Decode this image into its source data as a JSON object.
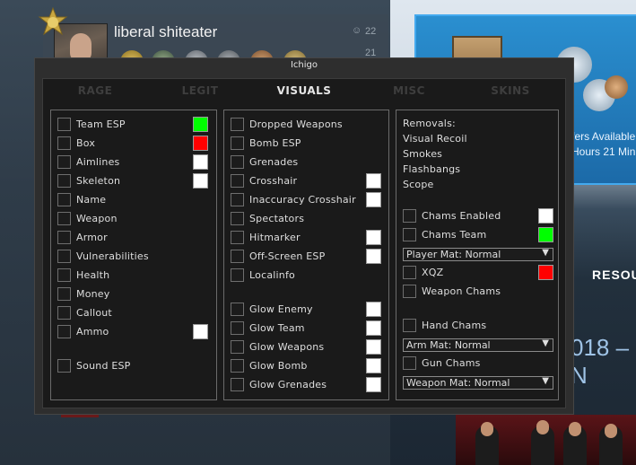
{
  "colors": {
    "team_esp": "#00ff00",
    "box": "#ff0000",
    "white": "#ffffff",
    "chams_team": "#00ff00",
    "xqz": "#ff0000"
  },
  "background": {
    "username": "liberal shiteater",
    "stat_1": "22",
    "stat_2": "21",
    "promo_line_1": "ffers Available",
    "promo_line_2": "Hours  21 Min",
    "resources_label": "RESOU",
    "year_text": "018 – N",
    "stray_s": "s"
  },
  "menu": {
    "title": "Ichigo",
    "tabs": [
      {
        "label": "RAGE",
        "active": false
      },
      {
        "label": "LEGIT",
        "active": false
      },
      {
        "label": "VISUALS",
        "active": true
      },
      {
        "label": "MISC",
        "active": false
      },
      {
        "label": "SKINS",
        "active": false
      }
    ],
    "col1": {
      "team_esp": "Team ESP",
      "box": "Box",
      "aimlines": "Aimlines",
      "skeleton": "Skeleton",
      "name": "Name",
      "weapon": "Weapon",
      "armor": "Armor",
      "vulnerabilities": "Vulnerabilities",
      "health": "Health",
      "money": "Money",
      "callout": "Callout",
      "ammo": "Ammo",
      "sound_esp": "Sound ESP"
    },
    "col2": {
      "dropped_weapons": "Dropped Weapons",
      "bomb_esp": "Bomb ESP",
      "grenades": "Grenades",
      "crosshair": "Crosshair",
      "inaccuracy_crosshair": "Inaccuracy Crosshair",
      "spectators": "Spectators",
      "hitmarker": "Hitmarker",
      "offscreen_esp": "Off-Screen ESP",
      "localinfo": "Localinfo",
      "glow_enemy": "Glow Enemy",
      "glow_team": "Glow Team",
      "glow_weapons": "Glow Weapons",
      "glow_bomb": "Glow Bomb",
      "glow_grenades": "Glow Grenades"
    },
    "col3": {
      "removals": "Removals:",
      "visual_recoil": "Visual Recoil",
      "smokes": "Smokes",
      "flashbangs": "Flashbangs",
      "scope": "Scope",
      "chams_enabled": "Chams Enabled",
      "chams_team": "Chams Team",
      "player_mat": "Player Mat: Normal",
      "xqz": "XQZ",
      "weapon_chams": "Weapon Chams",
      "hand_chams": "Hand Chams",
      "arm_mat": "Arm Mat: Normal",
      "gun_chams": "Gun Chams",
      "weapon_mat": "Weapon Mat: Normal"
    }
  }
}
